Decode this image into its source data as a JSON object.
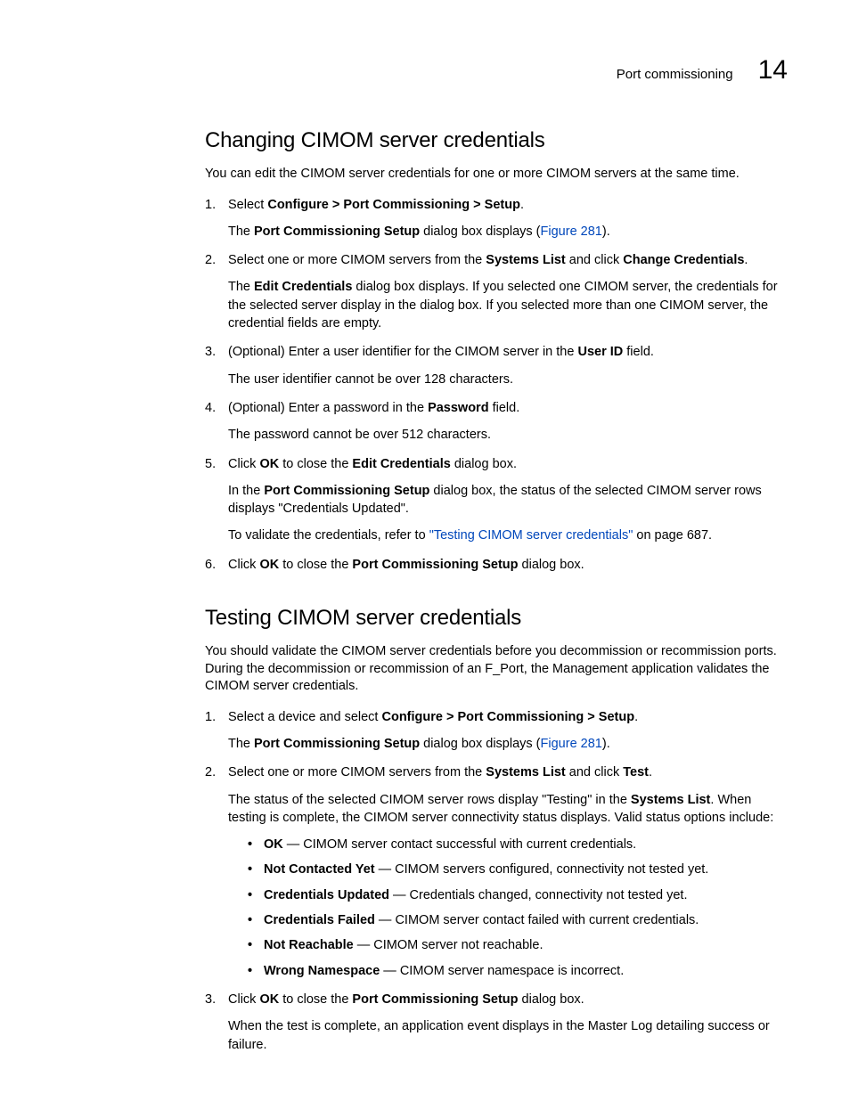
{
  "header": {
    "section": "Port commissioning",
    "chapter_number": "14"
  },
  "s1": {
    "heading": "Changing CIMOM server credentials",
    "intro": "You can edit the CIMOM server credentials for one or more CIMOM servers at the same time.",
    "step1_pre": "Select ",
    "step1_bold": "Configure > Port Commissioning > Setup",
    "step1_post": ".",
    "step1_sub_pre": "The ",
    "step1_sub_bold": "Port Commissioning Setup",
    "step1_sub_mid": " dialog box displays (",
    "step1_sub_link": "Figure 281",
    "step1_sub_post": ").",
    "step2_pre": "Select one or more CIMOM servers from the ",
    "step2_b1": "Systems List",
    "step2_mid": " and click ",
    "step2_b2": "Change Credentials",
    "step2_post": ".",
    "step2_sub_pre": "The ",
    "step2_sub_b": "Edit Credentials",
    "step2_sub_post": " dialog box displays. If you selected one CIMOM server, the credentials for the selected server display in the dialog box. If you selected more than one CIMOM server, the credential fields are empty.",
    "step3_pre": "(Optional) Enter a user identifier for the CIMOM server in the ",
    "step3_b": "User ID",
    "step3_post": " field.",
    "step3_sub": "The user identifier cannot be over 128 characters.",
    "step4_pre": "(Optional) Enter a password in the ",
    "step4_b": "Password",
    "step4_post": " field.",
    "step4_sub": "The password cannot be over 512 characters.",
    "step5_pre": "Click ",
    "step5_b1": "OK",
    "step5_mid": " to close the ",
    "step5_b2": "Edit Credentials",
    "step5_post": " dialog box.",
    "step5_sub1_pre": "In the ",
    "step5_sub1_b": "Port Commissioning Setup",
    "step5_sub1_post": " dialog box, the status of the selected CIMOM server rows displays \"Credentials Updated\".",
    "step5_sub2_pre": "To validate the credentials, refer to ",
    "step5_sub2_link": "\"Testing CIMOM server credentials\"",
    "step5_sub2_post": " on page 687.",
    "step6_pre": "Click ",
    "step6_b1": "OK",
    "step6_mid": " to close the ",
    "step6_b2": "Port Commissioning Setup",
    "step6_post": " dialog box."
  },
  "s2": {
    "heading": "Testing CIMOM server credentials",
    "intro": "You should validate the CIMOM server credentials before you decommission or recommission ports. During the decommission or recommission of an F_Port, the Management application validates the CIMOM server credentials.",
    "step1_pre": "Select a device and select ",
    "step1_b": "Configure > Port Commissioning > Setup",
    "step1_post": ".",
    "step1_sub_pre": "The ",
    "step1_sub_b": "Port Commissioning Setup",
    "step1_sub_mid": " dialog box displays (",
    "step1_sub_link": "Figure 281",
    "step1_sub_post": ").",
    "step2_pre": "Select one or more CIMOM servers from the ",
    "step2_b1": "Systems List",
    "step2_mid": " and click ",
    "step2_b2": "Test",
    "step2_post": ".",
    "step2_sub_pre": "The status of the selected CIMOM server rows display \"Testing\" in the ",
    "step2_sub_b": "Systems List",
    "step2_sub_post": ". When testing is complete, the CIMOM server connectivity status displays. Valid status options include:",
    "bullets": {
      "b1_name": "OK",
      "b1_desc": " — CIMOM server contact successful with current credentials.",
      "b2_name": "Not Contacted Yet",
      "b2_desc": " — CIMOM servers configured, connectivity not tested yet.",
      "b3_name": "Credentials Updated",
      "b3_desc": " — Credentials changed, connectivity not tested yet.",
      "b4_name": "Credentials Failed",
      "b4_desc": " — CIMOM server contact failed with current credentials.",
      "b5_name": "Not Reachable",
      "b5_desc": " — CIMOM server not reachable.",
      "b6_name": "Wrong Namespace",
      "b6_desc": " —  CIMOM server namespace is incorrect."
    },
    "step3_pre": "Click ",
    "step3_b1": "OK",
    "step3_mid": " to close the ",
    "step3_b2": "Port Commissioning Setup",
    "step3_post": " dialog box.",
    "step3_sub": "When the test is complete, an application event displays in the Master Log detailing success or failure."
  }
}
